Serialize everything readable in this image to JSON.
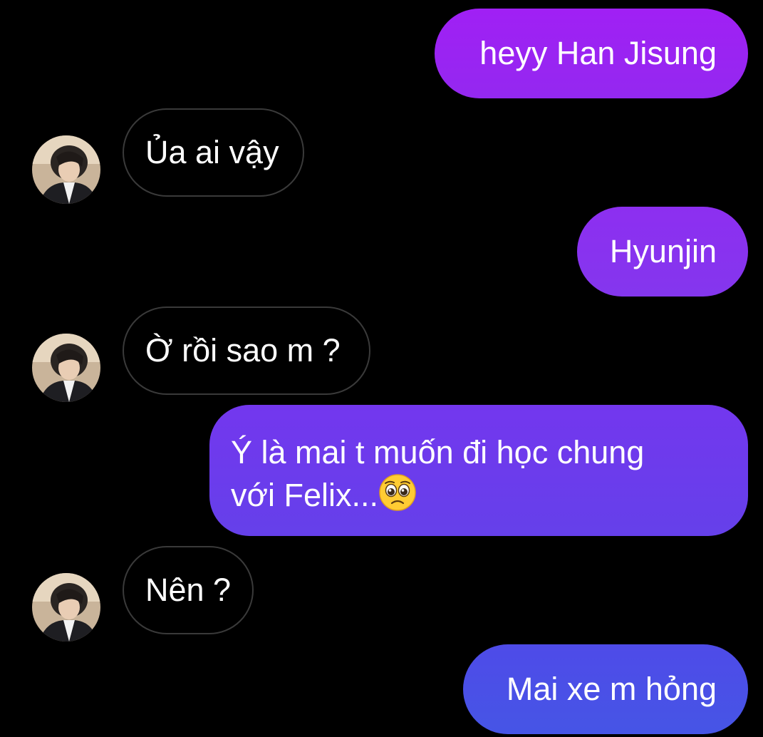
{
  "thread": {
    "contact_avatar_icon": "person-avatar-icon",
    "messages": [
      {
        "from": "me",
        "text": "heyy Han Jisung",
        "color": "#9b2df0"
      },
      {
        "from": "contact",
        "text": "Ủa ai vậy"
      },
      {
        "from": "me",
        "text": "Hyunjin",
        "color": "#8a33ee"
      },
      {
        "from": "contact",
        "text": "Ờ rồi sao m ?"
      },
      {
        "from": "me",
        "text_line1": "Ý là mai t muốn đi học chung",
        "text_line2": "với Felix...",
        "emoji": "pleading-face-icon",
        "color": "#6d3cec"
      },
      {
        "from": "contact",
        "text": "Nên ?"
      },
      {
        "from": "me",
        "text": "Mai xe m hỏng",
        "color": "#4a4ee6"
      }
    ]
  },
  "colors": {
    "background": "#000000",
    "received_bubble_border": "#3a3a3a",
    "text": "#ffffff"
  }
}
